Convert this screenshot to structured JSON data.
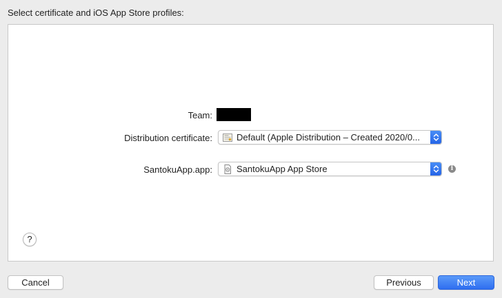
{
  "heading": "Select certificate and iOS App Store profiles:",
  "team": {
    "label": "Team:"
  },
  "certificate": {
    "label": "Distribution certificate:",
    "selected": "Default (Apple Distribution – Created 2020/0...",
    "icon": "certificate-icon"
  },
  "profile": {
    "label": "SantokuApp.app:",
    "selected": "SantokuApp App Store",
    "icon": "provisioning-profile-icon"
  },
  "help_label": "?",
  "info_label": "i",
  "buttons": {
    "cancel": "Cancel",
    "previous": "Previous",
    "next": "Next"
  },
  "colors": {
    "accent": "#2f6ef0",
    "panel": "#ffffff",
    "window": "#ececec"
  }
}
